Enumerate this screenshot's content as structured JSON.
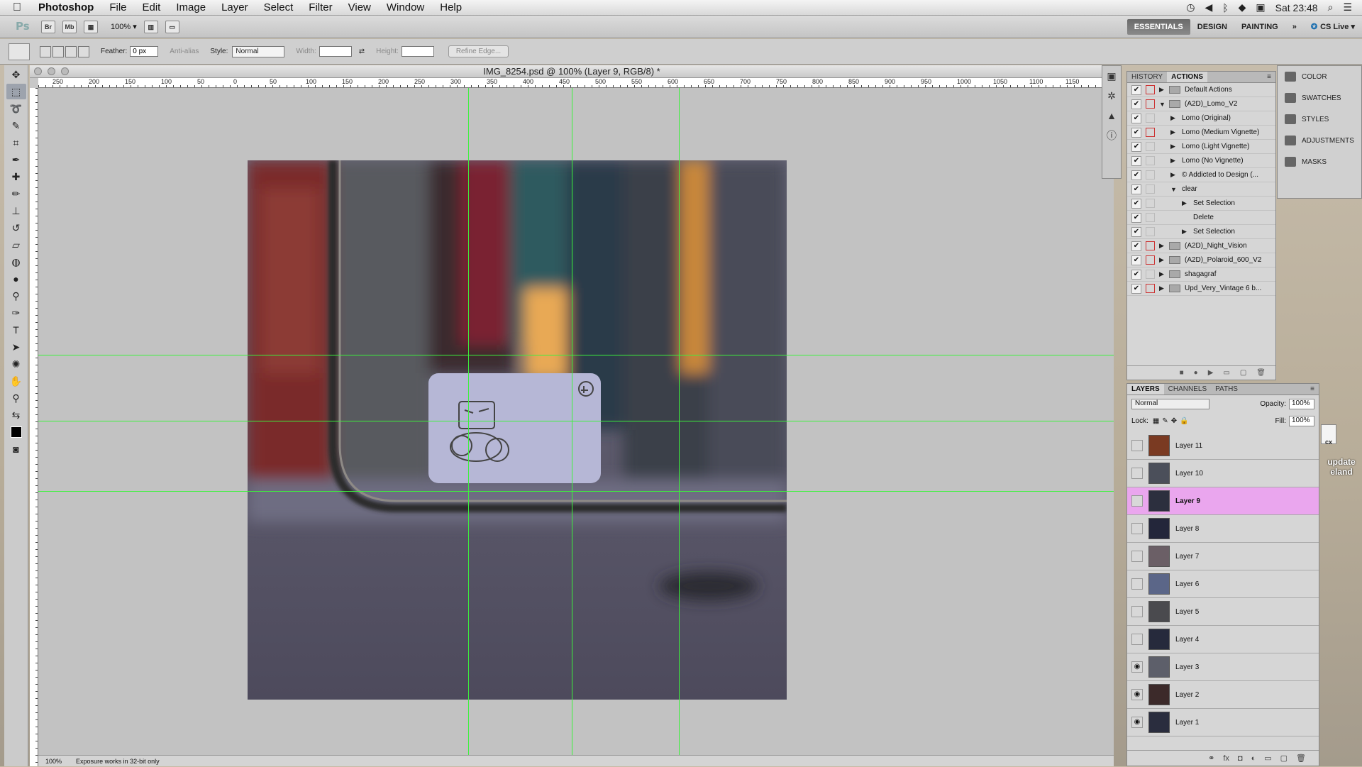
{
  "menubar": {
    "apple": "",
    "app_name": "Photoshop",
    "menus": [
      "File",
      "Edit",
      "Image",
      "Layer",
      "Select",
      "Filter",
      "View",
      "Window",
      "Help"
    ],
    "clock": "Sat 23:48"
  },
  "appbar": {
    "logo": "Ps",
    "bridge_label": "Br",
    "minibridge_label": "Mb",
    "zoom": "100%",
    "workspaces": [
      "ESSENTIALS",
      "DESIGN",
      "PAINTING"
    ],
    "more": "»",
    "cs_live": "CS Live"
  },
  "options": {
    "feather_label": "Feather:",
    "feather_value": "0 px",
    "antialias_label": "Anti-alias",
    "style_label": "Style:",
    "style_value": "Normal",
    "width_label": "Width:",
    "height_label": "Height:",
    "refine_label": "Refine Edge..."
  },
  "document": {
    "title": "IMG_8254.psd @ 100% (Layer 9, RGB/8) *",
    "ruler_labels": [
      "250",
      "200",
      "150",
      "100",
      "50",
      "0",
      "50",
      "100",
      "150",
      "200",
      "250",
      "300",
      "350",
      "400",
      "450",
      "500",
      "550",
      "600",
      "650",
      "700",
      "750",
      "800",
      "850",
      "900",
      "950",
      "1000",
      "1050",
      "1100",
      "1150"
    ],
    "status_zoom": "100%",
    "status_text": "Exposure works in 32-bit only"
  },
  "actions_panel": {
    "tabs": [
      "HISTORY",
      "ACTIONS"
    ],
    "rows": [
      {
        "label": "Default Actions",
        "indent": 0,
        "arrow": "▶",
        "folder": true,
        "dialog_red": true
      },
      {
        "label": "(A2D)_Lomo_V2",
        "indent": 0,
        "arrow": "▼",
        "folder": true,
        "dialog_red": true
      },
      {
        "label": "Lomo (Original)",
        "indent": 1,
        "arrow": "▶",
        "folder": false,
        "dialog_red": false
      },
      {
        "label": "Lomo (Medium Vignette)",
        "indent": 1,
        "arrow": "▶",
        "folder": false,
        "dialog_red": true
      },
      {
        "label": "Lomo (Light Vignette)",
        "indent": 1,
        "arrow": "▶",
        "folder": false,
        "dialog_red": false
      },
      {
        "label": "Lomo (No Vignette)",
        "indent": 1,
        "arrow": "▶",
        "folder": false,
        "dialog_red": false
      },
      {
        "label": "© Addicted to Design (...",
        "indent": 1,
        "arrow": "▶",
        "folder": false,
        "dialog_red": false
      },
      {
        "label": "clear",
        "indent": 1,
        "arrow": "▼",
        "folder": false,
        "dialog_red": false
      },
      {
        "label": "Set Selection",
        "indent": 2,
        "arrow": "▶",
        "folder": false,
        "dialog_red": false
      },
      {
        "label": "Delete",
        "indent": 2,
        "arrow": "",
        "folder": false,
        "dialog_red": false
      },
      {
        "label": "Set Selection",
        "indent": 2,
        "arrow": "▶",
        "folder": false,
        "dialog_red": false
      },
      {
        "label": "(A2D)_Night_Vision",
        "indent": 0,
        "arrow": "▶",
        "folder": true,
        "dialog_red": true
      },
      {
        "label": "(A2D)_Polaroid_600_V2",
        "indent": 0,
        "arrow": "▶",
        "folder": true,
        "dialog_red": true
      },
      {
        "label": "shagagraf",
        "indent": 0,
        "arrow": "▶",
        "folder": true,
        "dialog_red": false
      },
      {
        "label": "Upd_Very_Vintage 6 b...",
        "indent": 0,
        "arrow": "▶",
        "folder": true,
        "dialog_red": true
      }
    ]
  },
  "side_panel": {
    "items": [
      "COLOR",
      "SWATCHES",
      "STYLES",
      "ADJUSTMENTS",
      "MASKS"
    ]
  },
  "layers_panel": {
    "tabs": [
      "LAYERS",
      "CHANNELS",
      "PATHS"
    ],
    "blend_mode": "Normal",
    "opacity_label": "Opacity:",
    "opacity_value": "100%",
    "lock_label": "Lock:",
    "fill_label": "Fill:",
    "fill_value": "100%",
    "layers": [
      {
        "name": "Layer 11",
        "visible": false,
        "selected": false,
        "thumb": "#7a3a22"
      },
      {
        "name": "Layer 10",
        "visible": false,
        "selected": false,
        "thumb": "#4b4f5a"
      },
      {
        "name": "Layer 9",
        "visible": false,
        "selected": true,
        "thumb": "#2c2f3e"
      },
      {
        "name": "Layer 8",
        "visible": false,
        "selected": false,
        "thumb": "#23263a"
      },
      {
        "name": "Layer 7",
        "visible": false,
        "selected": false,
        "thumb": "#6b5f66"
      },
      {
        "name": "Layer 6",
        "visible": false,
        "selected": false,
        "thumb": "#5b6688"
      },
      {
        "name": "Layer 5",
        "visible": false,
        "selected": false,
        "thumb": "#4a4a4e"
      },
      {
        "name": "Layer 4",
        "visible": false,
        "selected": false,
        "thumb": "#262a3c"
      },
      {
        "name": "Layer 3",
        "visible": true,
        "selected": false,
        "thumb": "#5d5f6a"
      },
      {
        "name": "Layer 2",
        "visible": true,
        "selected": false,
        "thumb": "#3c2a2a"
      },
      {
        "name": "Layer 1",
        "visible": true,
        "selected": false,
        "thumb": "#2a2d3e"
      }
    ]
  },
  "desktop": {
    "icon_label": "update\neland",
    "icon_badge": "cx"
  },
  "colors": {
    "guide": "#3cf23c",
    "selected_layer": "#eaa6ee"
  }
}
